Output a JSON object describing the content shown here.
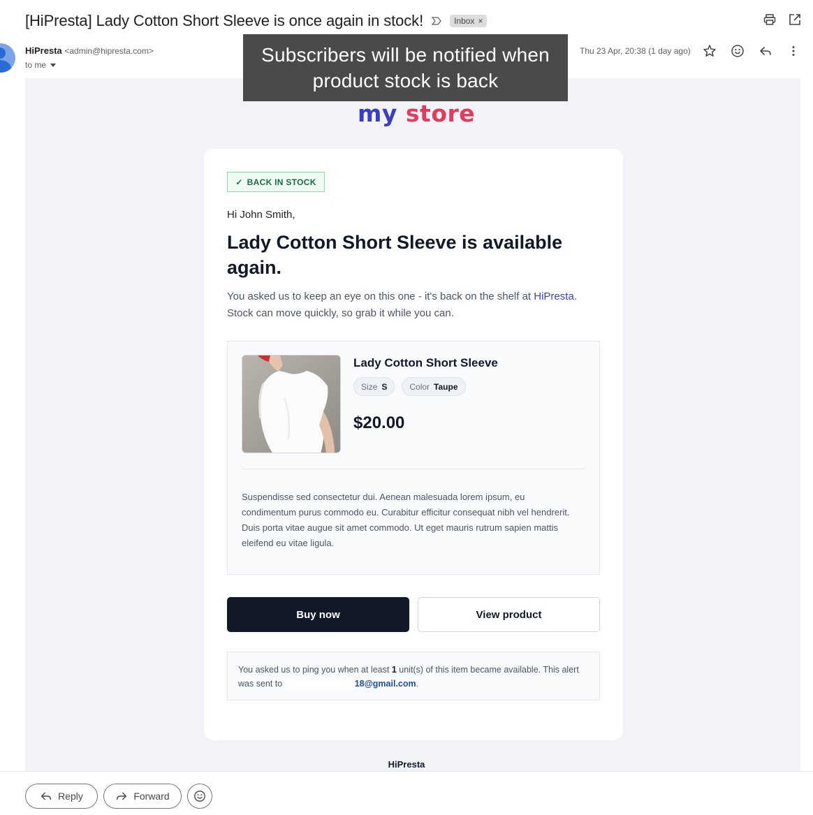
{
  "subject": {
    "title": "[HiPresta] Lady Cotton Short Sleeve is once again in stock!",
    "label_chip": "Inbox",
    "label_chip_close": "×"
  },
  "sender": {
    "name": "HiPresta",
    "email": "<admin@hipresta.com>",
    "to": "to me",
    "date": "Thu 23 Apr, 20:38 (1 day ago)"
  },
  "caption": {
    "line1": "Subscribers will be notified when",
    "line2": "product stock is back"
  },
  "logo": {
    "part1": "my",
    "part2": "store"
  },
  "email": {
    "badge": "BACK IN STOCK",
    "badge_check": "✓",
    "greeting": "Hi John Smith,",
    "headline": "Lady Cotton Short Sleeve is available again.",
    "intro_before": "You asked us to keep an eye on this one - it's back on the shelf at ",
    "intro_store": "HiPresta",
    "intro_after": ". Stock can move quickly, so grab it while you can.",
    "product": {
      "name": "Lady Cotton Short Sleeve",
      "attributes": [
        {
          "key": "Size",
          "value": "S"
        },
        {
          "key": "Color",
          "value": "Taupe"
        }
      ],
      "price": "$20.00",
      "description": "Suspendisse sed consectetur dui. Aenean malesuada lorem ipsum, eu condimentum purus commodo eu. Curabitur efficitur consequat nibh vel hendrerit. Duis porta vitae augue sit amet commodo. Ut eget mauris rutrum sapien mattis eleifend eu vitae ligula."
    },
    "buy_button": "Buy now",
    "view_button": "View product",
    "notice_part1": "You asked us to ping you when at least ",
    "notice_qty": "1",
    "notice_part2": " unit(s) of this item became available. This alert was sent to ",
    "notice_email": "18@gmail.com",
    "notice_end": ".",
    "footer_brand": "HiPresta"
  },
  "actions": {
    "reply": "Reply",
    "forward": "Forward"
  },
  "icons": [
    "importance-icon",
    "print-icon",
    "open-new-window-icon",
    "star-icon",
    "emoji-icon",
    "reply-icon",
    "more-vert-icon",
    "forward-icon"
  ],
  "colors": {
    "brand_blue": "#3b3fbf",
    "brand_red": "#e23b5b",
    "buy_button": "#111827",
    "badge_green": "#1d6b43"
  }
}
